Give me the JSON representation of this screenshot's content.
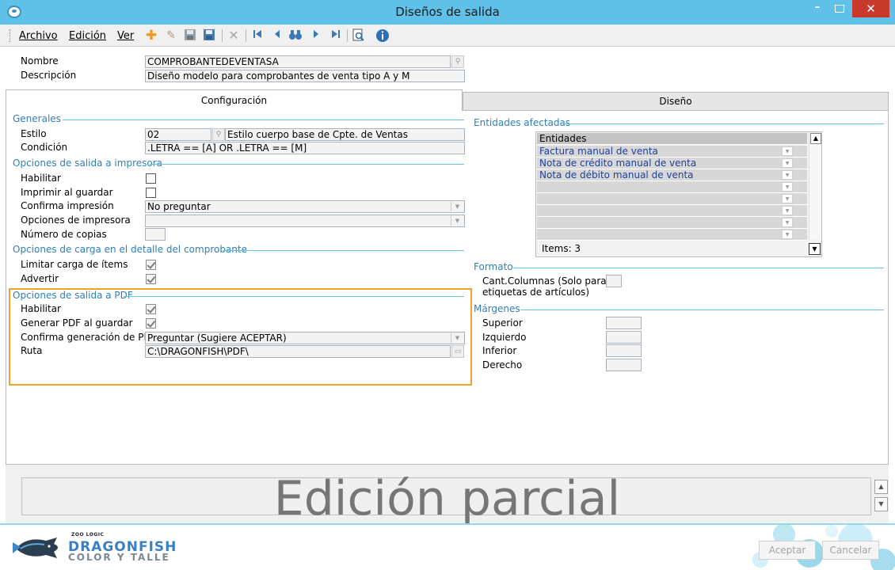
{
  "window": {
    "title": "Diseños de salida",
    "min_glyph": "–",
    "close_glyph": "✕"
  },
  "menu": {
    "archivo": "Archivo",
    "edicion": "Edición",
    "ver": "Ver"
  },
  "header": {
    "nombre_label": "Nombre",
    "nombre_value": "COMPROBANTEDEVENTASA",
    "descripcion_label": "Descripción",
    "descripcion_value": "Diseño modelo para comprobantes de venta tipo A y M"
  },
  "tabs": {
    "configuracion": "Configuración",
    "diseno": "Diseño"
  },
  "generales": {
    "title": "Generales",
    "estilo_label": "Estilo",
    "estilo_code": "02",
    "estilo_desc": "Estilo cuerpo base de Cpte. de Ventas",
    "condicion_label": "Condición",
    "condicion_value": ".LETRA == [A] OR .LETRA == [M]"
  },
  "impresora": {
    "title": "Opciones de salida a impresora",
    "habilitar_label": "Habilitar",
    "imprimir_label": "Imprimir al guardar",
    "confirma_label": "Confirma impresión",
    "confirma_value": "No preguntar",
    "opciones_label": "Opciones de impresora",
    "opciones_value": "",
    "copias_label": "Número de copias",
    "copias_value": ""
  },
  "carga": {
    "title": "Opciones de carga en el detalle del comprobante",
    "limitar_label": "Limitar carga de ítems",
    "advertir_label": "Advertir"
  },
  "pdf": {
    "title": "Opciones de salida a PDF",
    "habilitar_label": "Habilitar",
    "generar_label": "Generar PDF al guardar",
    "confirma_label": "Confirma generación de PDF",
    "confirma_value": "Preguntar (Sugiere ACEPTAR)",
    "ruta_label": "Ruta",
    "ruta_value": "C:\\DRAGONFISH\\PDF\\"
  },
  "entidades": {
    "title": "Entidades afectadas",
    "header": "Entidades",
    "rows": [
      "Factura manual de venta",
      "Nota de crédito manual de venta",
      "Nota de débito manual de venta",
      "",
      "",
      "",
      "",
      "",
      ""
    ],
    "items_label": "Items: 3"
  },
  "formato": {
    "title": "Formato",
    "columnas_label_1": "Cant.Columnas (Solo para",
    "columnas_label_2": "etiquetas de artículos)"
  },
  "margenes": {
    "title": "Márgenes",
    "superior": "Superior",
    "izquierdo": "Izquierdo",
    "inferior": "Inferior",
    "derecho": "Derecho"
  },
  "status": {
    "text": "Edición parcial"
  },
  "brand": {
    "small": "ZOO LOGIC",
    "main": "DRAGONFISH",
    "sub": "COLOR Y TALLE"
  },
  "buttons": {
    "aceptar": "Aceptar",
    "cancelar": "Cancelar"
  },
  "colors": {
    "accent": "#5fc0e8",
    "section": "#2f7fb5",
    "highlight": "#f0a22a",
    "close": "#c7392a"
  }
}
